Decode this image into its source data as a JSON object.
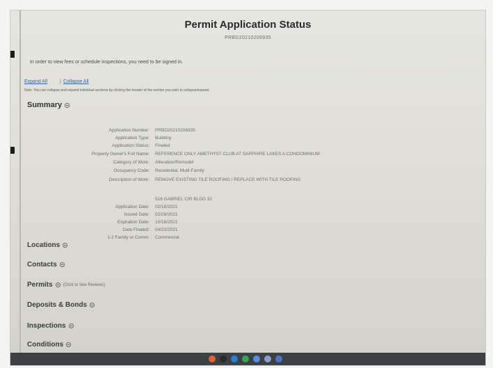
{
  "page": {
    "title": "Permit Application Status",
    "subtitle": "PRBD20210206935",
    "notice": "In order to view fees or schedule inspections, you need to be signed in.",
    "expand_all": "Expand All",
    "separator": "|",
    "collapse_all": "Collapse All",
    "note": "Note: You can collapse and expand individual sections by clicking the header of the section you wish to collapse/expand."
  },
  "summary": {
    "header": "Summary",
    "fields": [
      {
        "label": "Application Number:",
        "value": "PRBD20210206935"
      },
      {
        "label": "Application Type:",
        "value": "Building"
      },
      {
        "label": "Application Status:",
        "value": "Finaled"
      },
      {
        "label": "Property Owner's Full Name:",
        "value": "REFERENCE ONLY AMETHYST CLUB AT SAPPHIRE LAKES A CONDOMINIUM"
      },
      {
        "label": "Category of Work:",
        "value": "Alteration/Remodel"
      },
      {
        "label": "Occupancy Code:",
        "value": "Residential, Multi-Family"
      },
      {
        "label": "Description of Work:",
        "value": "REMOVE EXISTING TILE ROOFING / REPLACE WITH TILE ROOFING"
      },
      {
        "label": "",
        "value": "516 GABRIEL CIR BLDG 32"
      },
      {
        "label": "Application Date:",
        "value": "02/18/2021"
      },
      {
        "label": "Issued Date:",
        "value": "02/26/2021"
      },
      {
        "label": "Expiration Date:",
        "value": "10/18/2021"
      },
      {
        "label": "Date Finaled:",
        "value": "04/23/2021"
      },
      {
        "label": "1-2 Family or Comm:",
        "value": "Commercial"
      }
    ]
  },
  "sections": [
    {
      "name": "locations",
      "label": "Locations",
      "note": ""
    },
    {
      "name": "contacts",
      "label": "Contacts",
      "note": ""
    },
    {
      "name": "permits",
      "label": "Permits",
      "note": "(Click to See Reviews)"
    },
    {
      "name": "deposits-bonds",
      "label": "Deposits & Bonds",
      "note": ""
    },
    {
      "name": "inspections",
      "label": "Inspections",
      "note": ""
    },
    {
      "name": "conditions",
      "label": "Conditions",
      "note": ""
    }
  ],
  "taskbar_icon_colors": [
    "#e0623a",
    "#2b2b2b",
    "#2f7fd1",
    "#3aa055",
    "#5a8fd8",
    "#8aa0c8",
    "#4a78c0"
  ]
}
